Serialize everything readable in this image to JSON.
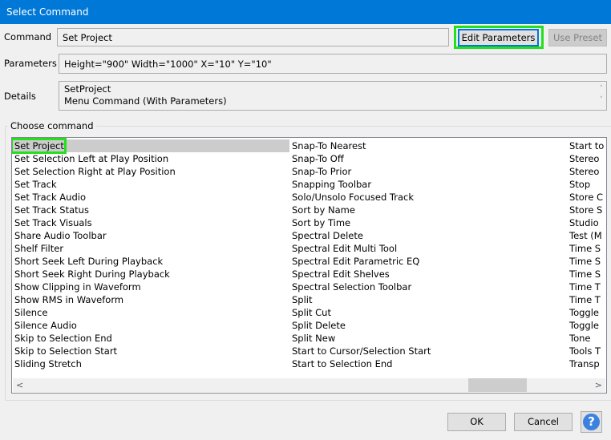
{
  "title": "Select Command",
  "command": {
    "label": "Command",
    "value": "Set Project",
    "edit_parameters": "Edit Parameters",
    "use_preset": "Use Preset"
  },
  "parameters": {
    "label": "Parameters",
    "value": "Height=\"900\" Width=\"1000\" X=\"10\" Y=\"10\""
  },
  "details": {
    "label": "Details",
    "line1": "SetProject",
    "line2": "Menu Command (With Parameters)"
  },
  "choose": {
    "label": "Choose command",
    "col1": [
      "Set Project",
      "Set Selection Left at Play Position",
      "Set Selection Right at Play Position",
      "Set Track",
      "Set Track Audio",
      "Set Track Status",
      "Set Track Visuals",
      "Share Audio Toolbar",
      "Shelf Filter",
      "Short Seek Left During Playback",
      "Short Seek Right During Playback",
      "Show Clipping in Waveform",
      "Show RMS in Waveform",
      "Silence",
      "Silence Audio",
      "Skip to Selection End",
      "Skip to Selection Start",
      "Sliding Stretch"
    ],
    "col2": [
      "Snap-To Nearest",
      "Snap-To Off",
      "Snap-To Prior",
      "Snapping Toolbar",
      "Solo/Unsolo Focused Track",
      "Sort by Name",
      "Sort by Time",
      "Spectral Delete",
      "Spectral Edit Multi Tool",
      "Spectral Edit Parametric EQ",
      "Spectral Edit Shelves",
      "Spectral Selection Toolbar",
      "Split",
      "Split Cut",
      "Split Delete",
      "Split New",
      "Start to Cursor/Selection Start",
      "Start to Selection End"
    ],
    "col3": [
      "Start to",
      "Stereo",
      "Stereo",
      "Stop",
      "Store C",
      "Store S",
      "Studio",
      "Test (M",
      "Time S",
      "Time S",
      "Time S",
      "Time T",
      "Time T",
      "Toggle",
      "Toggle",
      "Tone",
      "Tools T",
      "Transp"
    ]
  },
  "footer": {
    "ok": "OK",
    "cancel": "Cancel",
    "help": "?"
  }
}
